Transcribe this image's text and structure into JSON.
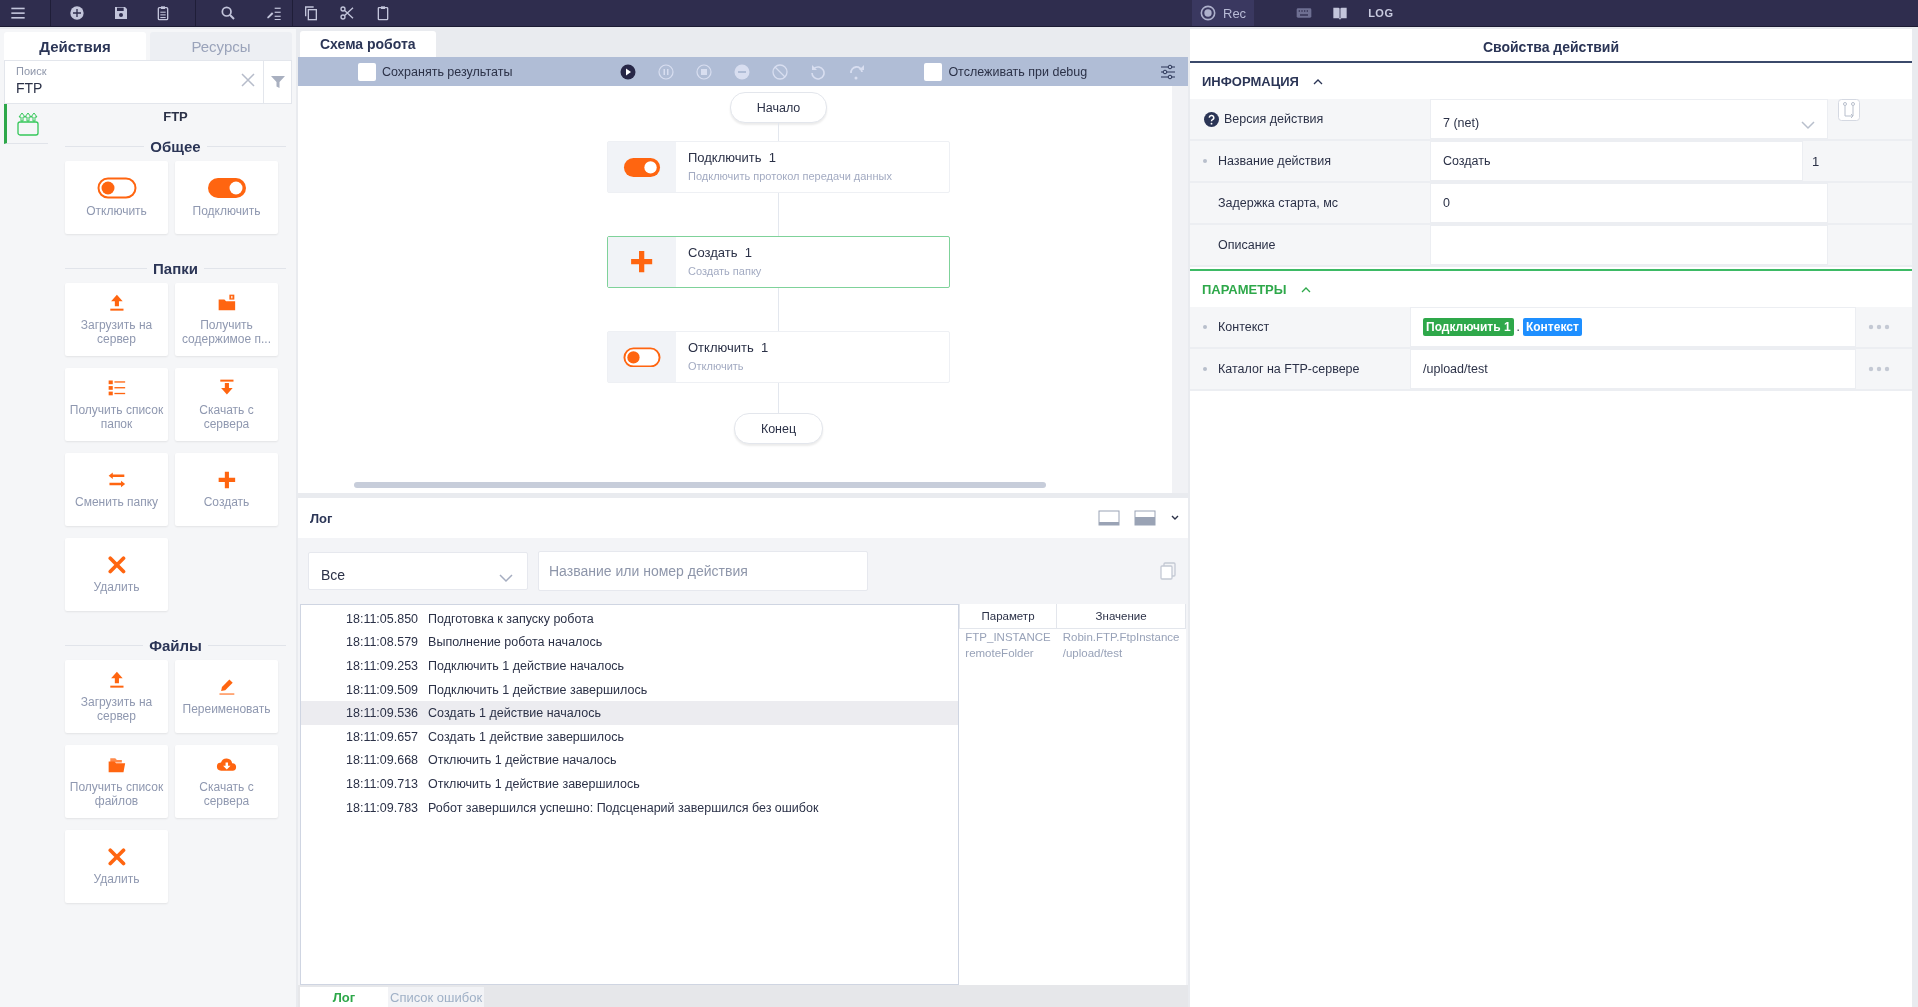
{
  "toolbar": {
    "rec": "Rec",
    "log": "LOG"
  },
  "actions_panel": {
    "tabs": [
      {
        "label": "Действия",
        "selected": true
      },
      {
        "label": "Ресурсы",
        "selected": false
      }
    ],
    "search": {
      "label": "Поиск",
      "value": "FTP"
    },
    "category": "FTP",
    "groups": [
      {
        "title": "Общее",
        "items": [
          {
            "label": "Отключить",
            "kind": "toggle-off"
          },
          {
            "label": "Подключить",
            "kind": "toggle-on"
          }
        ]
      },
      {
        "title": "Папки",
        "items": [
          {
            "label": "Загрузить на сервер",
            "kind": "upload"
          },
          {
            "label": "Получить содержимое п...",
            "kind": "folder-info"
          },
          {
            "label": "Получить список папок",
            "kind": "list"
          },
          {
            "label": "Скачать с сервера",
            "kind": "download"
          },
          {
            "label": "Сменить папку",
            "kind": "swap"
          },
          {
            "label": "Создать",
            "kind": "plus"
          },
          {
            "label": "Удалить",
            "kind": "cross"
          }
        ]
      },
      {
        "title": "Файлы",
        "items": [
          {
            "label": "Загрузить на сервер",
            "kind": "upload"
          },
          {
            "label": "Переименовать",
            "kind": "pencil"
          },
          {
            "label": "Получить список файлов",
            "kind": "files"
          },
          {
            "label": "Скачать с сервера",
            "kind": "cloud-download"
          },
          {
            "label": "Удалить",
            "kind": "cross"
          }
        ]
      }
    ]
  },
  "schema": {
    "tab": "Схема робота",
    "save_results": {
      "label": "Сохранять результаты",
      "checked": false
    },
    "debug": {
      "label": "Отслеживать при debug",
      "checked": false
    },
    "start": "Начало",
    "nodes": [
      {
        "title": "Подключить",
        "number": "1",
        "subtitle": "Подключить протокол передачи данных",
        "kind": "toggle-on",
        "selected": false
      },
      {
        "title": "Создать",
        "number": "1",
        "subtitle": "Создать папку",
        "kind": "plus",
        "selected": true
      },
      {
        "title": "Отключить",
        "number": "1",
        "subtitle": "Отключить",
        "kind": "toggle-off",
        "selected": false
      }
    ],
    "end": "Конец"
  },
  "log": {
    "title": "Лог",
    "filter": "Все",
    "search": {
      "placeholder": "Название или номер действия"
    },
    "entries": [
      {
        "time": "18:11:05.850",
        "message": "Подготовка к запуску робота",
        "selected": false
      },
      {
        "time": "18:11:08.579",
        "message": "Выполнение робота началось",
        "selected": false
      },
      {
        "time": "18:11:09.253",
        "message": "Подключить 1 действие началось",
        "selected": false
      },
      {
        "time": "18:11:09.509",
        "message": "Подключить 1 действие завершилось",
        "selected": false
      },
      {
        "time": "18:11:09.536",
        "message": "Создать 1 действие началось",
        "selected": true
      },
      {
        "time": "18:11:09.657",
        "message": "Создать 1 действие завершилось",
        "selected": false
      },
      {
        "time": "18:11:09.668",
        "message": "Отключить 1 действие началось",
        "selected": false
      },
      {
        "time": "18:11:09.713",
        "message": "Отключить 1 действие завершилось",
        "selected": false
      },
      {
        "time": "18:11:09.783",
        "message": "Робот завершился успешно: Подсценарий завершился без ошибок",
        "selected": false
      }
    ],
    "params": {
      "columns": [
        "Параметр",
        "Значение"
      ],
      "rows": [
        [
          "FTP_INSTANCE",
          "Robin.FTP.FtpInstance"
        ],
        [
          "remoteFolder",
          "/upload/test"
        ]
      ]
    },
    "tabs": [
      {
        "label": "Лог",
        "selected": true
      },
      {
        "label": "Список ошибок",
        "selected": false
      }
    ]
  },
  "properties": {
    "title": "Свойства действий",
    "info": {
      "title": "ИНФОРМАЦИЯ",
      "expanded": true,
      "fields": [
        {
          "label": "Версия действия",
          "value": "7 (net)",
          "kind": "dropdown",
          "required": false
        },
        {
          "label": "Название действия",
          "value": "Создать",
          "number": "1",
          "kind": "indexed",
          "required": true
        },
        {
          "label": "Задержка старта, мс",
          "value": "0",
          "kind": "text",
          "required": false
        },
        {
          "label": "Описание",
          "kind": "text",
          "required": false
        }
      ]
    },
    "params": {
      "title": "ПАРАМЕТРЫ",
      "expanded": true,
      "rows": [
        {
          "label": "Контекст",
          "required": true,
          "kind": "tags",
          "separator": ".",
          "tags": [
            {
              "text": "Подключить 1",
              "color": "#2ea84a"
            },
            {
              "text": "Контекст",
              "color": "#1e8fff"
            }
          ]
        },
        {
          "label": "Каталог на FTP-сервере",
          "required": true,
          "kind": "text",
          "value": "/upload/test"
        }
      ]
    }
  }
}
